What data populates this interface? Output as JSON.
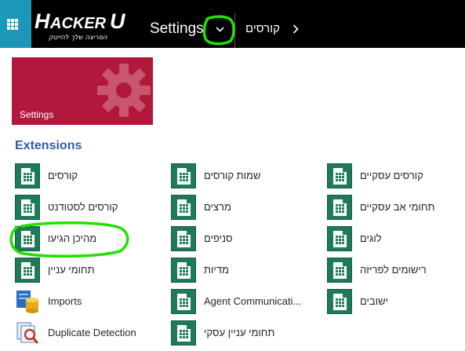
{
  "nav": {
    "logo_text": "HACKERU",
    "logo_tagline": "הפריצה שלך להייטק",
    "title": "Settings",
    "breadcrumb": "קורסים"
  },
  "tile": {
    "label": "Settings"
  },
  "section": {
    "title": "Extensions"
  },
  "extensions": [
    "קורסים",
    "שמות קורסים",
    "קורסים עסקיים",
    "קורסים לסטודנט",
    "מרצים",
    "תחומי אב עסקיים",
    "מהיכן הגיעו",
    "סניפים",
    "לוגים",
    "תחומי עניין",
    "מדיות",
    "רישומים לפריזה",
    "Imports",
    "Agent Communicati...",
    "ישובים",
    "Duplicate Detection",
    "תחומי עניין עסקי"
  ],
  "colors": {
    "waffle": "#1d97b8",
    "tile": "#b2173c",
    "section_title": "#2f5fa3",
    "entity_icon": "#1f7a58",
    "annotation": "#22e000"
  },
  "icons": {
    "waffle": "app-launcher-icon",
    "dropdown": "chevron-down-icon",
    "breadcrumb": "chevron-right-icon",
    "tile": "gear-icon",
    "entity": "entity-icon",
    "imports": "imports-icon",
    "duplicate": "duplicate-detection-icon"
  }
}
